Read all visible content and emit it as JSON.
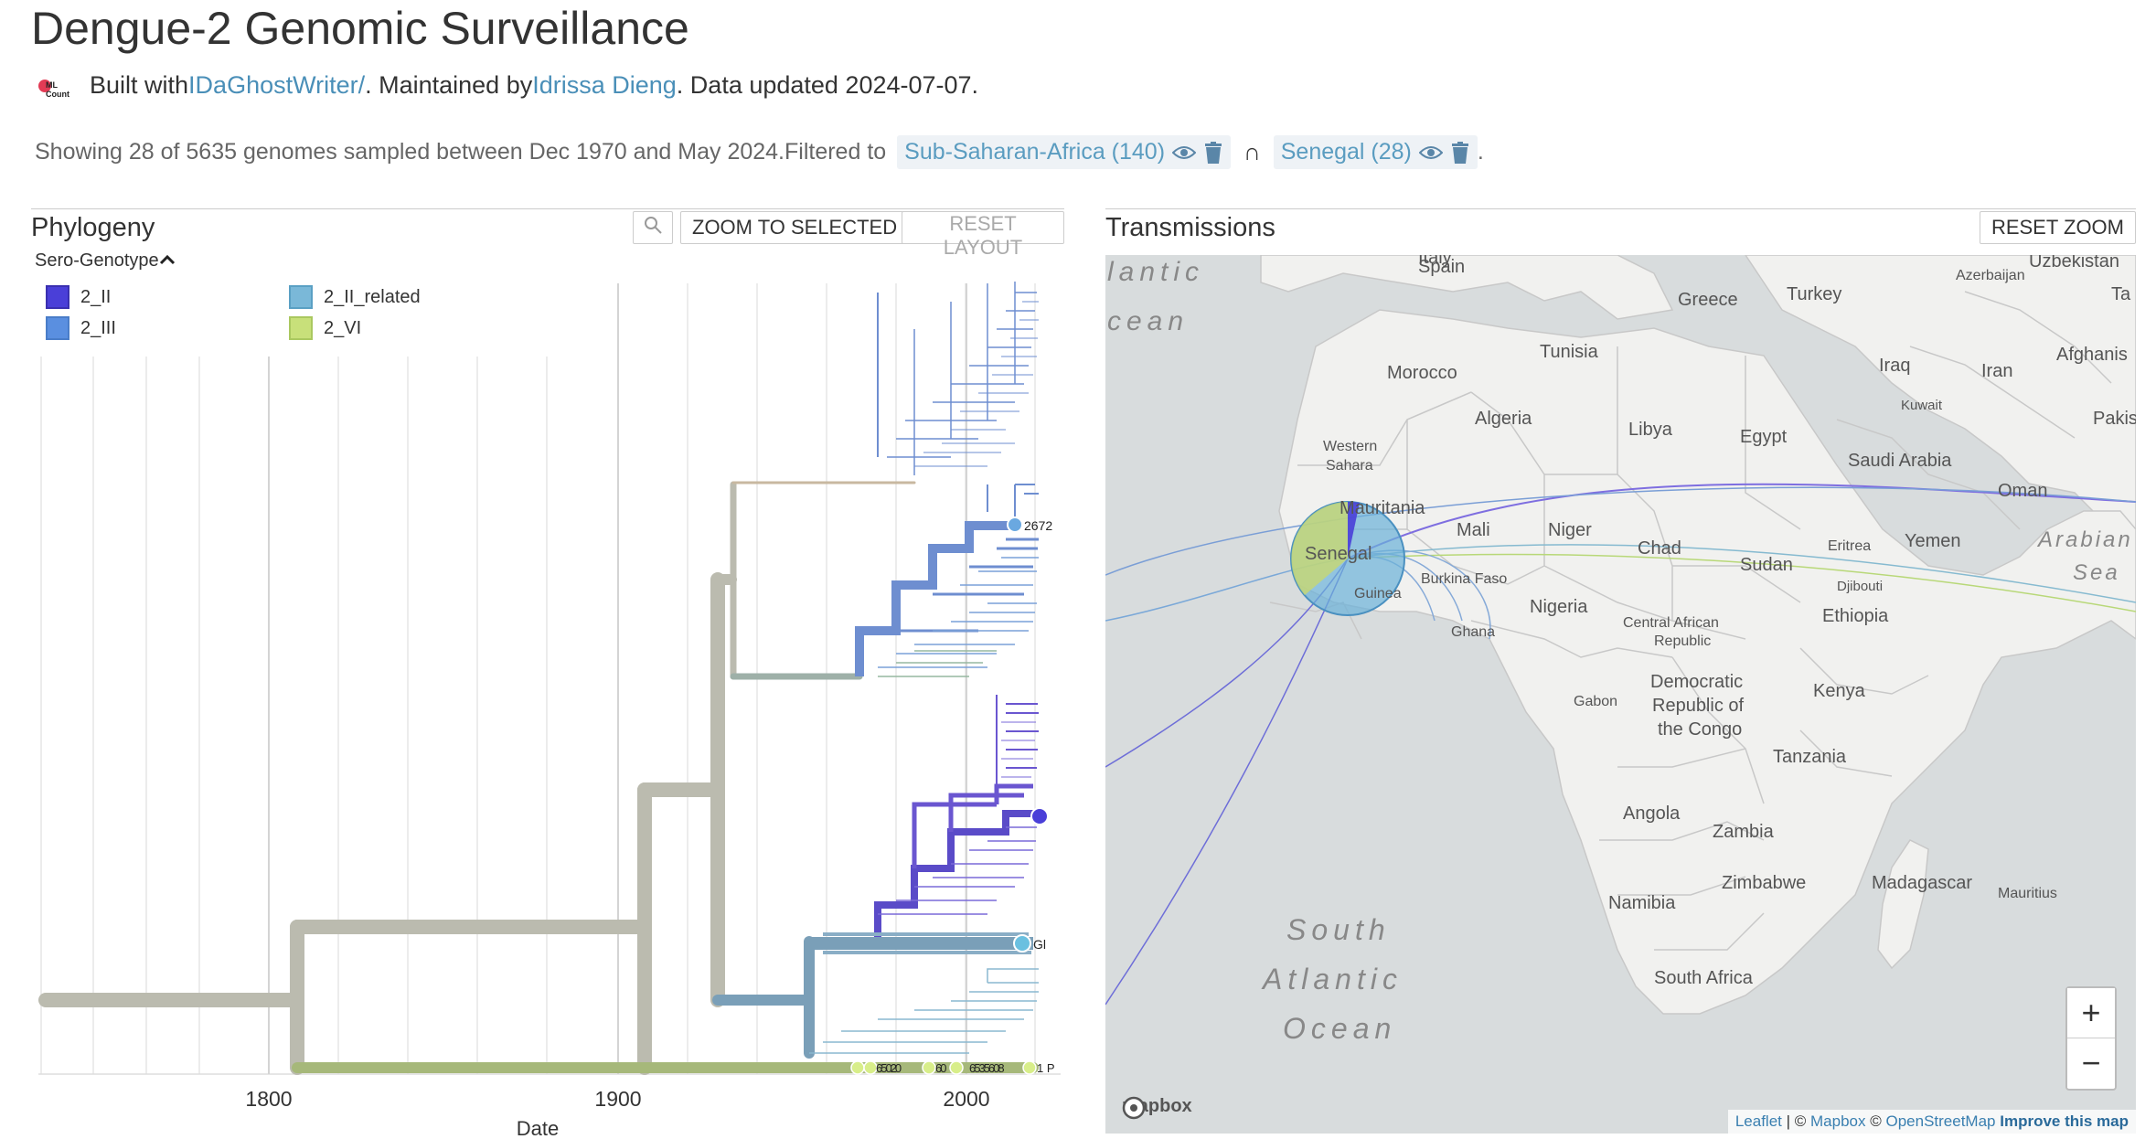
{
  "header": {
    "title": "Dengue-2 Genomic Surveillance",
    "built_with": "Built with ",
    "built_link": "IDaGhostWriter/",
    "maintained": ". Maintained by ",
    "maintainer": "Idrissa Dieng",
    "updated": ". Data updated 2024-07-07.",
    "logo_text": "ML Count"
  },
  "filters": {
    "summary": "Showing 28 of 5635 genomes sampled between Dec 1970 and May 2024.Filtered to",
    "chip1": "Sub-Saharan-Africa (140)",
    "intersect": "∩",
    "chip2": "Senegal (28)",
    "end": "."
  },
  "phylogeny": {
    "title": "Phylogeny",
    "zoom_icon": "magnifier-icon",
    "zoom_selected": "ZOOM TO SELECTED",
    "reset_layout": "RESET LAYOUT",
    "legend_title": "Sero-Genotype",
    "legend": [
      {
        "label": "2_II",
        "color": "#4a3fd8"
      },
      {
        "label": "2_III",
        "color": "#5a8fe0"
      },
      {
        "label": "2_II_related",
        "color": "#7ab8d8"
      },
      {
        "label": "2_VI",
        "color": "#c8e07a"
      }
    ],
    "axis_ticks": [
      "1800",
      "1900",
      "2000"
    ],
    "axis_label": "Date",
    "tip_labels": [
      "2672",
      "Gl",
      "1 P"
    ]
  },
  "transmissions": {
    "title": "Transmissions",
    "reset_zoom": "RESET ZOOM",
    "labels": {
      "spain": "Spain",
      "italy": "Italy",
      "greece": "Greece",
      "turkey": "Turkey",
      "azerbaijan": "Azerbaijan",
      "uzbekistan": "Uzbekistan",
      "tajik": "Ta",
      "atlantic1": "lantic",
      "atlantic2": "cean",
      "morocco": "Morocco",
      "tunisia": "Tunisia",
      "iraq": "Iraq",
      "iran": "Iran",
      "afghanistan": "Afghanis",
      "algeria": "Algeria",
      "libya": "Libya",
      "egypt": "Egypt",
      "kuwait": "Kuwait",
      "pakistan": "Pakis",
      "western_sahara1": "Western",
      "western_sahara2": "Sahara",
      "saudi": "Saudi Arabia",
      "oman": "Oman",
      "mauritania": "Mauritania",
      "mali": "Mali",
      "niger": "Niger",
      "chad": "Chad",
      "eritrea": "Eritrea",
      "yemen": "Yemen",
      "arabian1": "Arabian",
      "arabian2": "Sea",
      "senegal": "Senegal",
      "burkina": "Burkina Faso",
      "sudan": "Sudan",
      "djibouti": "Djibouti",
      "guinea": "Guinea",
      "nigeria": "Nigeria",
      "ethiopia": "Ethiopia",
      "ghana": "Ghana",
      "car1": "Central African",
      "car2": "Republic",
      "drc1": "Democratic",
      "drc2": "Republic of",
      "drc3": "the Congo",
      "kenya": "Kenya",
      "gabon": "Gabon",
      "tanzania": "Tanzania",
      "angola": "Angola",
      "zambia": "Zambia",
      "south1": "South",
      "south2": "Atlantic",
      "south3": "Ocean",
      "zimbabwe": "Zimbabwe",
      "madagascar": "Madagascar",
      "mauritius": "Mauritius",
      "namibia": "Namibia",
      "south_africa": "South Africa"
    },
    "zoom_in": "+",
    "zoom_out": "−",
    "mapbox": "mapbox",
    "attribution": {
      "leaflet": "Leaflet",
      "sep1": " | © ",
      "mapbox": "Mapbox",
      "sep2": " © ",
      "osm": "OpenStreetMap",
      "sep3": " ",
      "improve": "Improve this map"
    }
  }
}
